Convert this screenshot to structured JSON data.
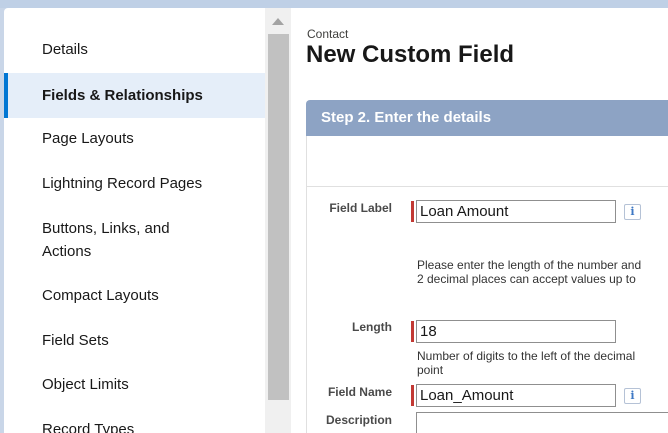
{
  "sidebar": {
    "items": [
      {
        "label": "Details"
      },
      {
        "label": "Fields & Relationships"
      },
      {
        "label": "Page Layouts"
      },
      {
        "label": "Lightning Record Pages"
      },
      {
        "label": "Buttons, Links, and"
      },
      {
        "label": "Actions"
      },
      {
        "label": "Compact Layouts"
      },
      {
        "label": "Field Sets"
      },
      {
        "label": "Object Limits"
      },
      {
        "label": "Record Types"
      }
    ],
    "active_item": "Fields & Relationships"
  },
  "header": {
    "breadcrumb": "Contact",
    "title": "New Custom Field"
  },
  "step": {
    "title": "Step 2. Enter the details"
  },
  "form": {
    "field_label": {
      "label": "Field Label",
      "value": "Loan Amount"
    },
    "length_help_line1": "Please enter the length of the number and",
    "length_help_line2": "2 decimal places can accept values up to",
    "length": {
      "label": "Length",
      "value": "18"
    },
    "length_hint_line1": "Number of digits to the left of the decimal",
    "length_hint_line2": "point",
    "field_name": {
      "label": "Field Name",
      "value": "Loan_Amount"
    },
    "description": {
      "label": "Description",
      "value": ""
    },
    "info_icon_glyph": "i"
  },
  "colors": {
    "accent": "#0176d3",
    "step_header": "#8da3c4",
    "required": "#c23934"
  }
}
